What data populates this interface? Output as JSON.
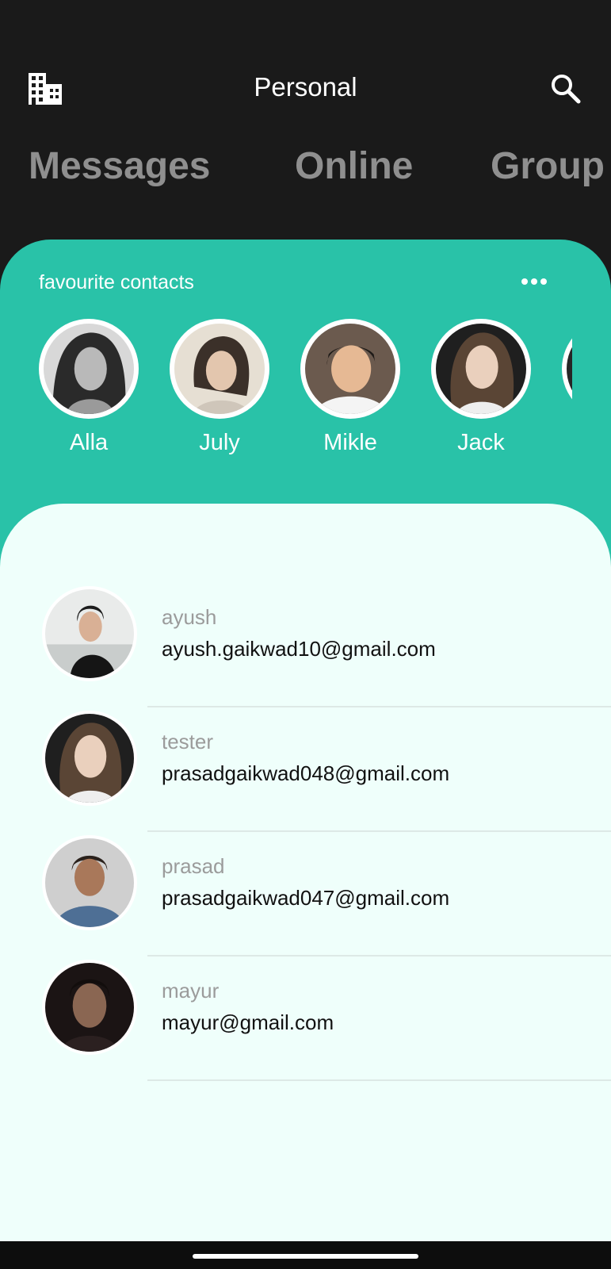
{
  "header": {
    "title": "Personal",
    "left_icon": "building-icon",
    "right_icon": "search-icon"
  },
  "tabs": [
    {
      "label": "Messages"
    },
    {
      "label": "Online"
    },
    {
      "label": "Group"
    }
  ],
  "favourites": {
    "title": "favourite contacts",
    "menu_icon": "more-horizontal-icon",
    "contacts": [
      {
        "name": "Alla"
      },
      {
        "name": "July"
      },
      {
        "name": "Mikle"
      },
      {
        "name": "Jack"
      }
    ]
  },
  "contacts": [
    {
      "name": "ayush",
      "email": "ayush.gaikwad10@gmail.com"
    },
    {
      "name": "tester",
      "email": "prasadgaikwad048@gmail.com"
    },
    {
      "name": "prasad",
      "email": "prasadgaikwad047@gmail.com"
    },
    {
      "name": "mayur",
      "email": "mayur@gmail.com"
    }
  ],
  "colors": {
    "background": "#1a1a1a",
    "accent": "#29c2a8",
    "list_background": "#effffb",
    "tab_text": "#8f8f8f"
  }
}
